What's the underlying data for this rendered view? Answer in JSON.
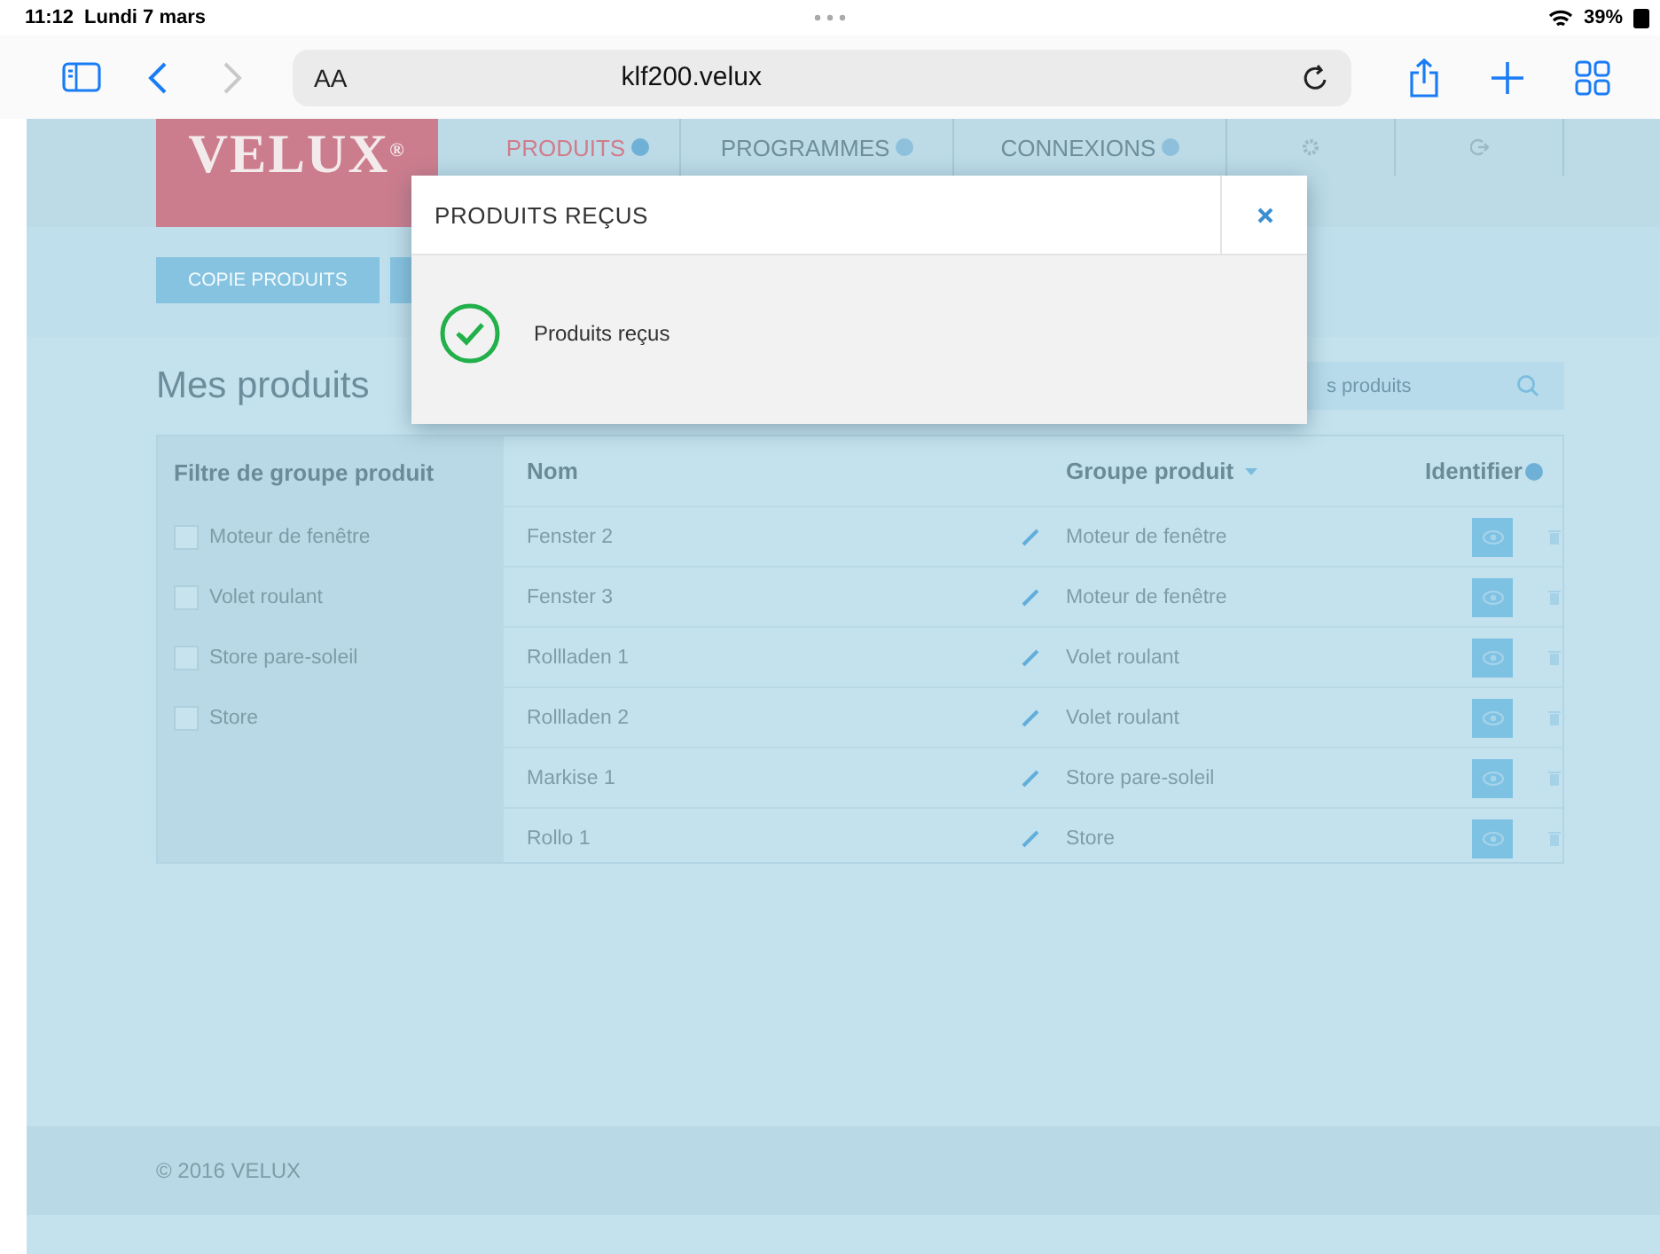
{
  "status_bar": {
    "time": "11:12",
    "date": "Lundi 7 mars",
    "battery": "39%"
  },
  "browser": {
    "text_size": "AA",
    "url": "klf200.velux"
  },
  "header": {
    "logo": "VELUX",
    "logo_mark": "®",
    "nav": [
      {
        "label": "PRODUITS",
        "selected": true
      },
      {
        "label": "PROGRAMMES",
        "selected": false
      },
      {
        "label": "CONNEXIONS",
        "selected": false
      }
    ]
  },
  "toolbar": {
    "buttons": [
      "COPIE PRODUITS"
    ]
  },
  "heading": "Mes produits",
  "search": {
    "placeholder": "s produits"
  },
  "filter": {
    "title": "Filtre de groupe produit",
    "items": [
      {
        "label": "Moteur de fenêtre",
        "checked": false
      },
      {
        "label": "Volet roulant",
        "checked": false
      },
      {
        "label": "Store pare-soleil",
        "checked": false
      },
      {
        "label": "Store",
        "checked": false
      }
    ]
  },
  "table": {
    "columns": [
      "Nom",
      "Groupe produit",
      "Identifier"
    ],
    "rows": [
      {
        "name": "Fenster 2",
        "group": "Moteur de fenêtre"
      },
      {
        "name": "Fenster 3",
        "group": "Moteur de fenêtre"
      },
      {
        "name": "Rollladen 1",
        "group": "Volet roulant"
      },
      {
        "name": "Rollladen 2",
        "group": "Volet roulant"
      },
      {
        "name": "Markise 1",
        "group": "Store pare-soleil"
      },
      {
        "name": "Rollo 1",
        "group": "Store"
      }
    ]
  },
  "modal": {
    "title": "PRODUITS REÇUS",
    "message": "Produits reçus"
  },
  "footer": "© 2016 VELUX"
}
